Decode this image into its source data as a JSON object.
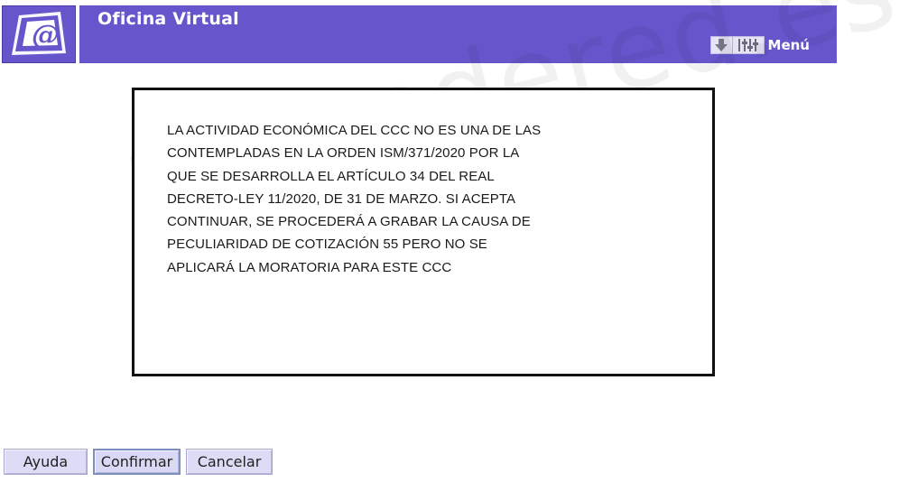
{
  "header": {
    "title": "Oficina Virtual",
    "menu_label": "Menú",
    "logo_icon": "at-sign-logo-icon",
    "colors": {
      "bar": "#6656cc",
      "text": "#ffffff"
    }
  },
  "message": {
    "text": "LA ACTIVIDAD ECONÓMICA DEL CCC NO ES UNA DE LAS\nCONTEMPLADAS EN LA ORDEN ISM/371/2020 POR LA\nQUE SE DESARROLLA EL ARTÍCULO 34 DEL REAL\nDECRETO-LEY 11/2020, DE 31 DE MARZO. SI ACEPTA\nCONTINUAR, SE PROCEDERÁ A GRABAR LA CAUSA DE\nPECULIARIDAD DE COTIZACIÓN 55 PERO NO SE\nAPLICARÁ LA MORATORIA PARA ESTE CCC"
  },
  "watermark": "aprendered.es",
  "buttons": {
    "help": "Ayuda",
    "confirm": "Confirmar",
    "cancel": "Cancelar"
  },
  "icons": {
    "menu_down": "download-arrow-icon",
    "menu_settings": "sliders-icon"
  }
}
